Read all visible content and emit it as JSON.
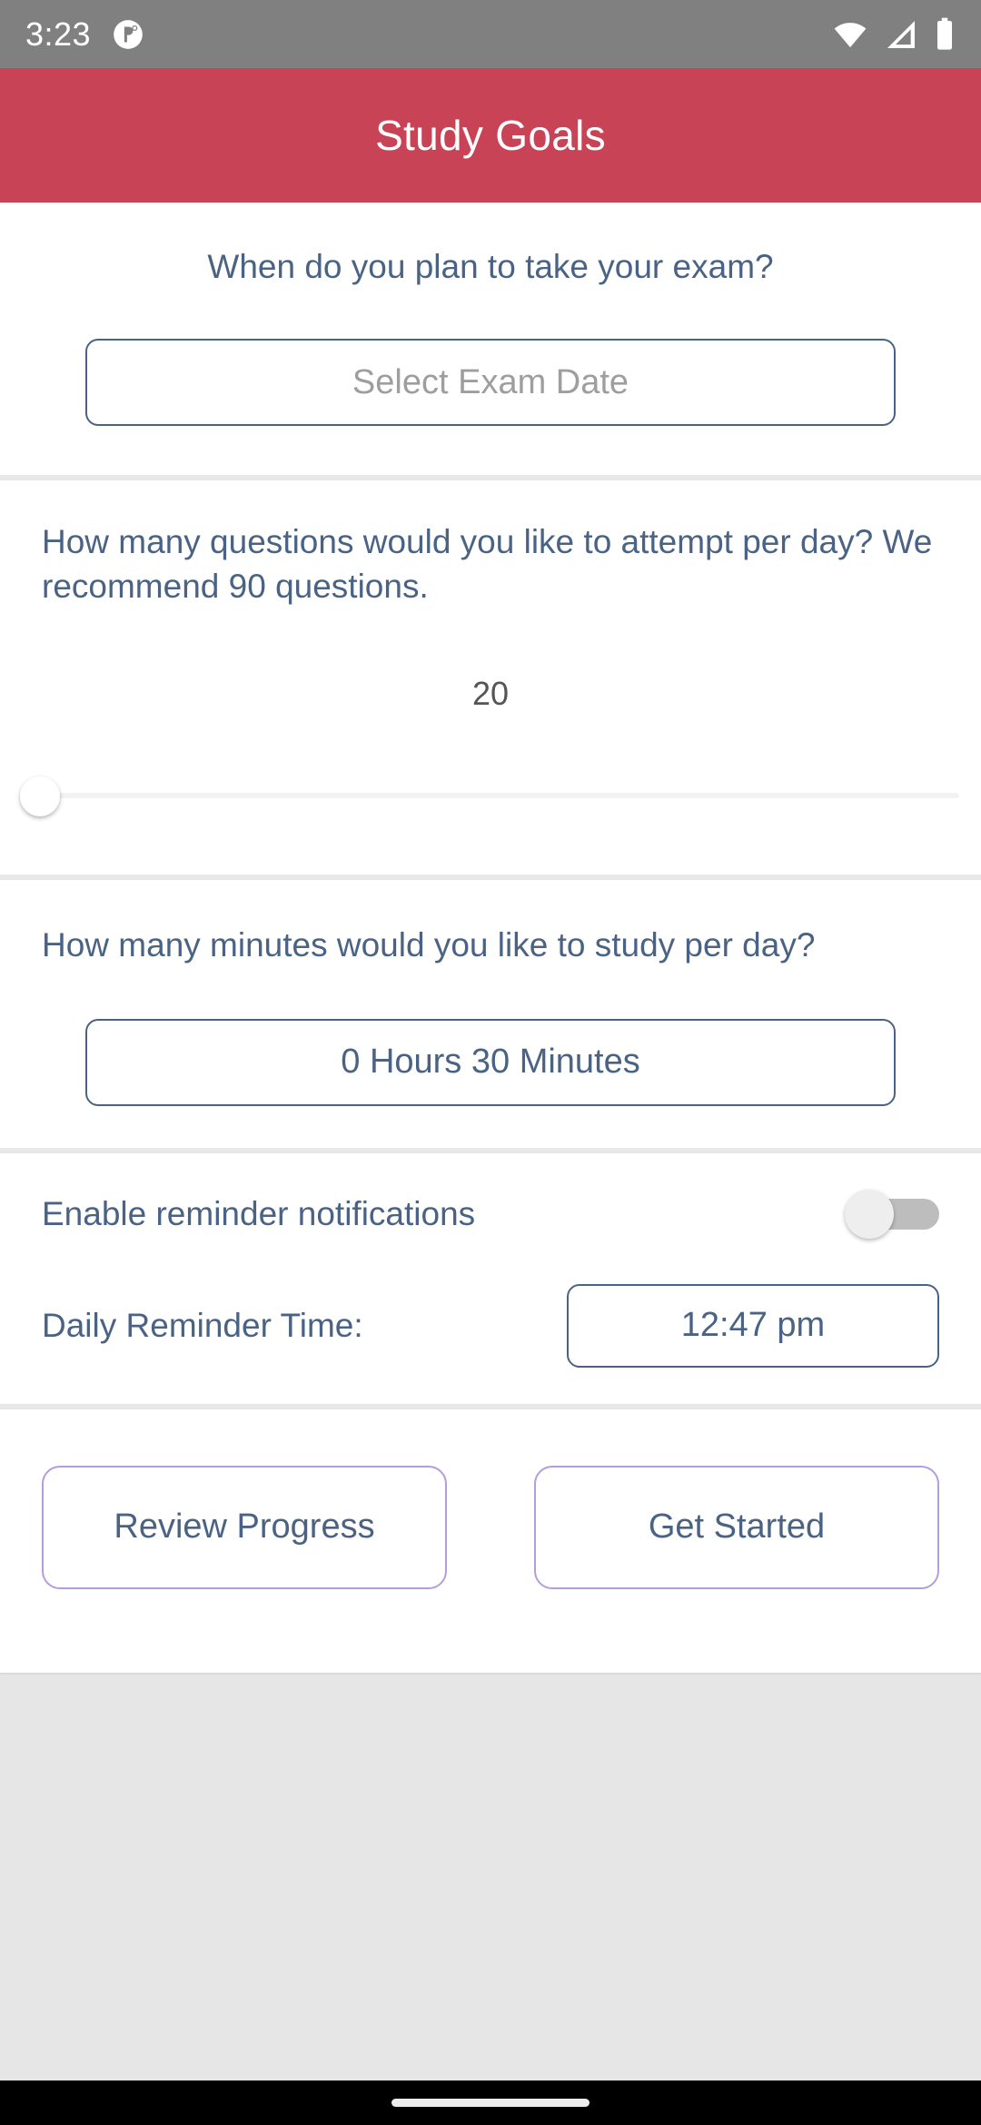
{
  "status_bar": {
    "time": "3:23",
    "icons": {
      "notification": "app-notification-icon",
      "wifi": "wifi-icon",
      "cellular": "cellular-signal-icon",
      "battery": "battery-full-icon"
    }
  },
  "app_bar": {
    "title": "Study Goals",
    "background_color": "#c94356",
    "title_color": "#ffffff"
  },
  "theme": {
    "accent_blue": "#4a6385",
    "accent_purple": "#b39ddb",
    "placeholder_gray": "#9e9e9e",
    "value_gray": "#555555"
  },
  "exam_date_section": {
    "question": "When do you plan to take your exam?",
    "button_placeholder": "Select Exam Date",
    "button_value": ""
  },
  "questions_per_day_section": {
    "question": "How many questions would you like to attempt per day? We recommend 90 questions.",
    "recommended": 90,
    "value": "20",
    "slider": {
      "value": 20,
      "position_percent": 0
    }
  },
  "minutes_per_day_section": {
    "question": "How many minutes would you like to study per day?",
    "duration_value": "0 Hours 30 Minutes",
    "hours": 0,
    "minutes": 30
  },
  "reminders_section": {
    "notifications_label": "Enable reminder notifications",
    "notifications_enabled": false,
    "reminder_time_label": "Daily Reminder Time:",
    "reminder_time_value": "12:47 pm"
  },
  "actions": {
    "review_progress_label": "Review Progress",
    "get_started_label": "Get Started"
  }
}
